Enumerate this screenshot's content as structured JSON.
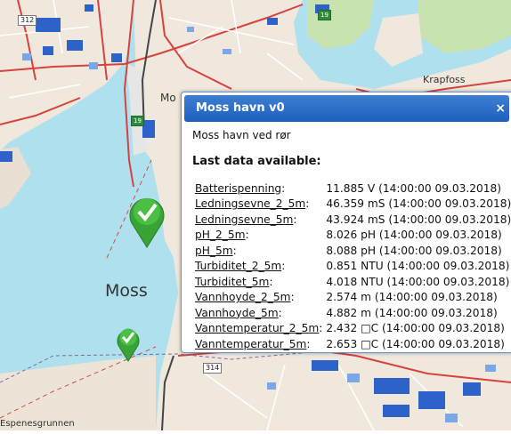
{
  "map": {
    "colors": {
      "water": "#aee0ee",
      "land": "#f0e8dc",
      "park": "#c9e3b0",
      "road_main": "#d6423e",
      "building_dark": "#2d63c8",
      "building_light": "#7aa7e8"
    },
    "labels": {
      "town": "Moss",
      "town_partial": "Mo",
      "place": "Krapfoss",
      "water_area": "Espenesgrunnen"
    },
    "road_numbers": [
      "312",
      "19",
      "19",
      "314"
    ],
    "markers": [
      {
        "name": "station-marker-large",
        "icon": "checkmark-icon",
        "color": "#3aa335"
      },
      {
        "name": "station-marker-small",
        "icon": "checkmark-icon",
        "color": "#3aa335"
      }
    ]
  },
  "popup": {
    "title": "Moss havn v0",
    "close_glyph": "×",
    "subtitle": "Moss havn ved rør",
    "last_data_label": "Last data available:",
    "rows": [
      {
        "name": "Batterispenning",
        "value": "11.885 V (14:00:00 09.03.2018)"
      },
      {
        "name": "Ledningsevne_2_5m",
        "value": "46.359 mS (14:00:00 09.03.2018)"
      },
      {
        "name": "Ledningsevne_5m",
        "value": "43.924 mS (14:00:00 09.03.2018)"
      },
      {
        "name": "pH_2_5m",
        "value": "8.026 pH (14:00:00 09.03.2018)"
      },
      {
        "name": "pH_5m",
        "value": "8.088 pH (14:00:00 09.03.2018)"
      },
      {
        "name": "Turbiditet_2_5m",
        "value": "0.851 NTU (14:00:00 09.03.2018)"
      },
      {
        "name": "Turbiditet_5m",
        "value": "4.018 NTU (14:00:00 09.03.2018)"
      },
      {
        "name": "Vannhoyde_2_5m",
        "value": "2.574 m (14:00:00 09.03.2018)"
      },
      {
        "name": "Vannhoyde_5m",
        "value": "4.882 m (14:00:00 09.03.2018)"
      },
      {
        "name": "Vanntemperatur_2_5m",
        "value": "2.432 □C (14:00:00 09.03.2018)"
      },
      {
        "name": "Vanntemperatur_5m",
        "value": "2.653 □C (14:00:00 09.03.2018)"
      }
    ]
  }
}
